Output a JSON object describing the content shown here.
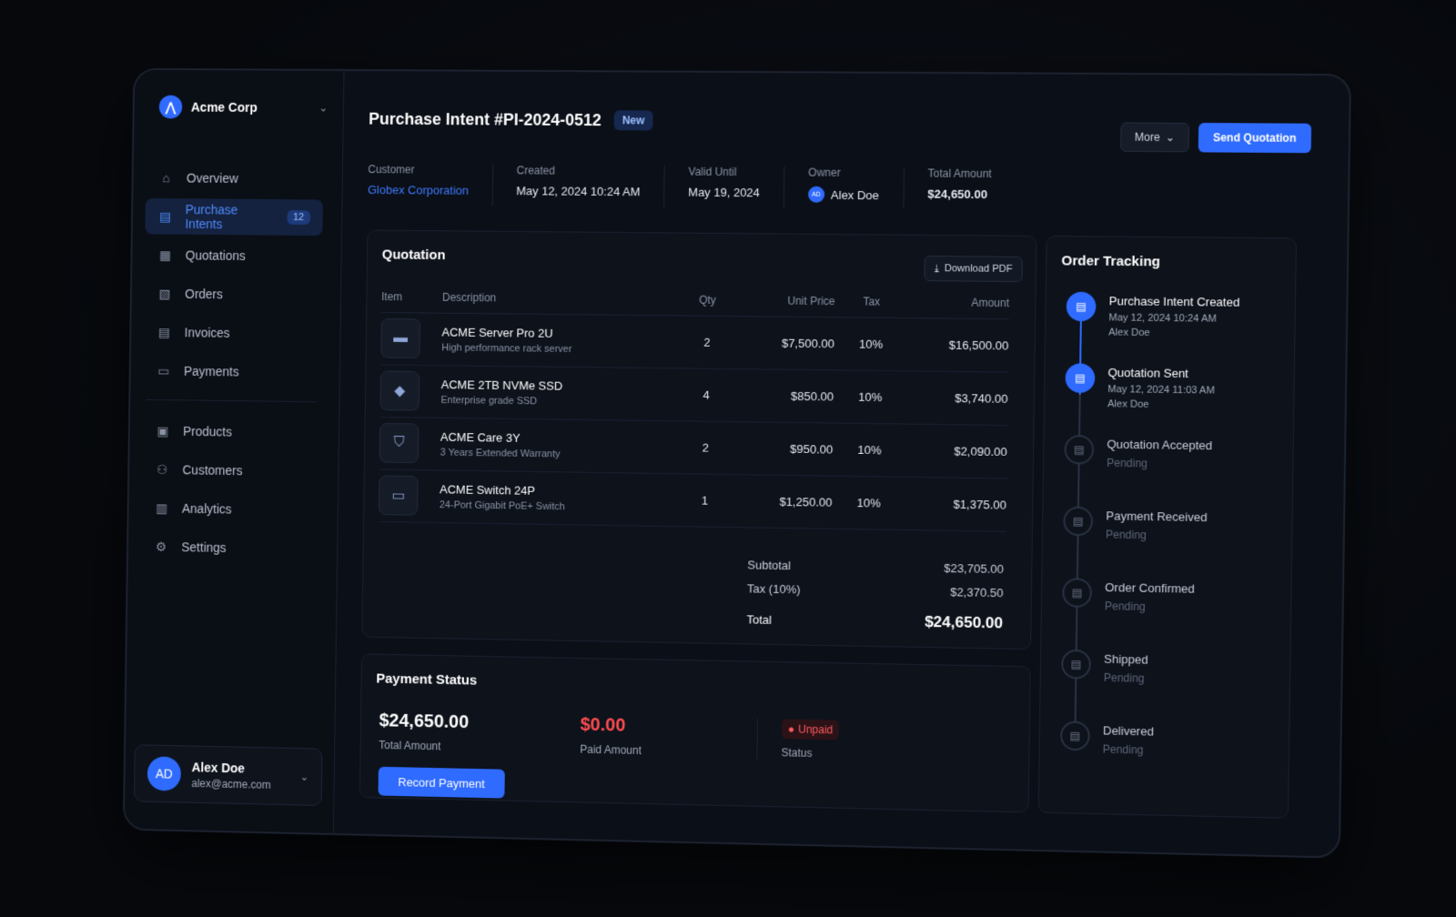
{
  "sidebar": {
    "brand": "Acme Corp",
    "items": [
      {
        "label": "Overview",
        "icon": "home-icon"
      },
      {
        "label": "Purchase Intents",
        "icon": "document-icon",
        "badge": "12",
        "active": true
      },
      {
        "label": "Quotations",
        "icon": "quote-icon"
      },
      {
        "label": "Orders",
        "icon": "orders-icon"
      },
      {
        "label": "Invoices",
        "icon": "invoice-icon"
      },
      {
        "label": "Payments",
        "icon": "payment-icon"
      }
    ],
    "items2": [
      {
        "label": "Products",
        "icon": "products-icon"
      },
      {
        "label": "Customers",
        "icon": "customers-icon"
      },
      {
        "label": "Analytics",
        "icon": "analytics-icon"
      },
      {
        "label": "Settings",
        "icon": "gear-icon"
      }
    ],
    "user": {
      "initials": "AD",
      "name": "Alex Doe",
      "email": "alex@acme.com"
    }
  },
  "header": {
    "title": "Purchase Intent #PI-2024-0512",
    "status_badge": "New",
    "more_label": "More",
    "send_label": "Send Quotation"
  },
  "meta": {
    "customer_label": "Customer",
    "customer": "Globex Corporation",
    "created_label": "Created",
    "created": "May 12, 2024 10:24 AM",
    "valid_label": "Valid Until",
    "valid": "May 19, 2024",
    "owner_label": "Owner",
    "owner_initials": "AD",
    "owner": "Alex Doe",
    "total_label": "Total Amount",
    "total": "$24,650.00"
  },
  "quotation": {
    "title": "Quotation",
    "download_label": "Download PDF",
    "columns": {
      "item": "Item",
      "description": "Description",
      "qty": "Qty",
      "unit_price": "Unit Price",
      "tax": "Tax",
      "amount": "Amount"
    },
    "rows": [
      {
        "name": "ACME Server Pro 2U",
        "desc": "High performance rack server",
        "qty": "2",
        "price": "$7,500.00",
        "tax": "10%",
        "amount": "$16,500.00",
        "icon": "server-icon"
      },
      {
        "name": "ACME 2TB NVMe SSD",
        "desc": "Enterprise grade SSD",
        "qty": "4",
        "price": "$850.00",
        "tax": "10%",
        "amount": "$3,740.00",
        "icon": "ssd-icon"
      },
      {
        "name": "ACME Care 3Y",
        "desc": "3 Years Extended Warranty",
        "qty": "2",
        "price": "$950.00",
        "tax": "10%",
        "amount": "$2,090.00",
        "icon": "shield-icon"
      },
      {
        "name": "ACME Switch 24P",
        "desc": "24-Port Gigabit PoE+ Switch",
        "qty": "1",
        "price": "$1,250.00",
        "tax": "10%",
        "amount": "$1,375.00",
        "icon": "switch-icon"
      }
    ],
    "subtotal_label": "Subtotal",
    "subtotal": "$23,705.00",
    "tax_label": "Tax (10%)",
    "tax": "$2,370.50",
    "total_label": "Total",
    "total": "$24,650.00"
  },
  "payment": {
    "title": "Payment Status",
    "total": "$24,650.00",
    "total_label": "Total Amount",
    "paid": "$0.00",
    "paid_label": "Paid Amount",
    "status": "Unpaid",
    "status_label": "Status",
    "record_label": "Record Payment"
  },
  "tracking": {
    "title": "Order Tracking",
    "steps": [
      {
        "title": "Purchase Intent Created",
        "date": "May 12, 2024 10:24 AM",
        "by": "Alex Doe"
      },
      {
        "title": "Quotation Sent",
        "date": "May 12, 2024 11:03 AM",
        "by": "Alex Doe"
      },
      {
        "title": "Quotation Accepted",
        "status": "Pending"
      },
      {
        "title": "Payment Received",
        "status": "Pending"
      },
      {
        "title": "Order Confirmed",
        "status": "Pending"
      },
      {
        "title": "Shipped",
        "status": "Pending"
      },
      {
        "title": "Delivered",
        "status": "Pending"
      }
    ]
  },
  "colors": {
    "accent": "#2f6bff",
    "danger": "#ff4d4f",
    "background": "#0b0f17"
  }
}
